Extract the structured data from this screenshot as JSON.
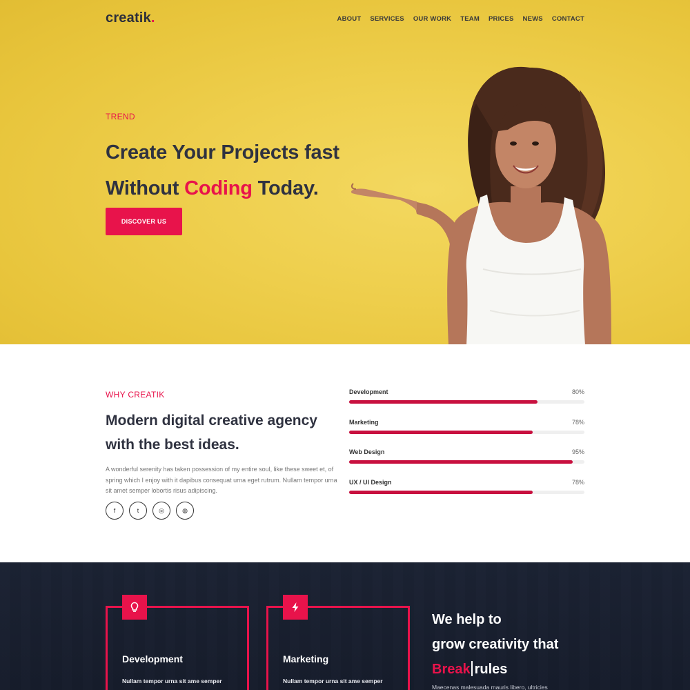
{
  "brand": {
    "name": "creatik",
    "dot": "."
  },
  "nav": [
    {
      "label": "ABOUT"
    },
    {
      "label": "SERVICES"
    },
    {
      "label": "OUR WORK"
    },
    {
      "label": "TEAM"
    },
    {
      "label": "PRICES"
    },
    {
      "label": "NEWS"
    },
    {
      "label": "CONTACT"
    }
  ],
  "hero": {
    "eyebrow": "TREND",
    "line1": "Create Your Projects fast",
    "line2_before": "Without ",
    "line2_accent": "Coding",
    "line2_after": " Today.",
    "cta": "DISCOVER US"
  },
  "about": {
    "eyebrow": "WHY CREATIK",
    "title_line1": "Modern digital creative agency",
    "title_line2": "with the best ideas.",
    "body": "A wonderful serenity has taken possession of my entire soul, like these sweet et, of spring which I enjoy with it dapibus consequat urna eget rutrum. Nullam tempor urna sit amet semper lobortis risus adipiscing.",
    "socials": [
      {
        "icon": "facebook-icon",
        "glyph": "f"
      },
      {
        "icon": "twitter-icon",
        "glyph": "t"
      },
      {
        "icon": "instagram-icon",
        "glyph": "◎"
      },
      {
        "icon": "dribbble-icon",
        "glyph": "◍"
      }
    ]
  },
  "skills": [
    {
      "name": "Development",
      "label": "80%",
      "value": 80
    },
    {
      "name": "Marketing",
      "label": "78%",
      "value": 78
    },
    {
      "name": "Web Design",
      "label": "95%",
      "value": 95
    },
    {
      "name": "UX / UI Design",
      "label": "78%",
      "value": 78
    }
  ],
  "services": [
    {
      "title": "Development",
      "icon": "lightbulb-icon",
      "text": "Nullam tempor urna sit ame semper lobortis risus adipiscing sapien which"
    },
    {
      "title": "Marketing",
      "icon": "lightning-icon",
      "text": "Nullam tempor urna sit ame semper lobortis risus adipiscing sapien which"
    }
  ],
  "help": {
    "line1": "We help to",
    "line2": "grow creativity that",
    "accent": "Break",
    "after": "rules",
    "body": "Maecenas malesuada mauris libero, ultricies"
  },
  "colors": {
    "accent": "#e8134b",
    "bar": "#c8103f",
    "hero_bg": "#efd04f",
    "dark_bg": "#1b2233"
  }
}
